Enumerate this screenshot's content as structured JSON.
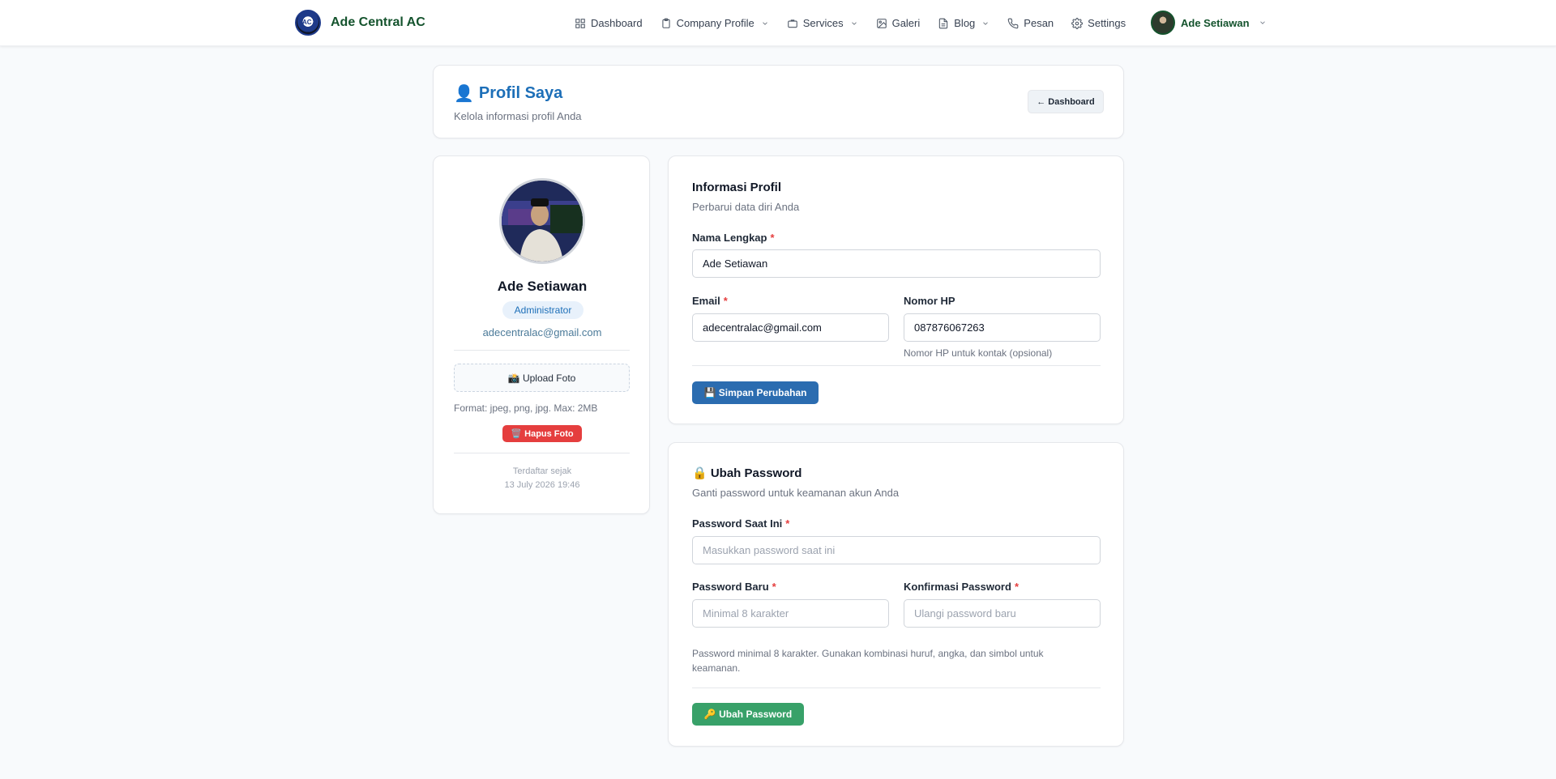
{
  "navbar": {
    "brand_name": "Ade Central AC",
    "items": [
      {
        "label": "Dashboard"
      },
      {
        "label": "Company Profile"
      },
      {
        "label": "Services"
      },
      {
        "label": "Galeri"
      },
      {
        "label": "Blog"
      },
      {
        "label": "Pesan"
      },
      {
        "label": "Settings"
      }
    ],
    "user_name": "Ade Setiawan"
  },
  "header": {
    "icon": "👤",
    "title": "Profil Saya",
    "subtitle": "Kelola informasi profil Anda",
    "back_label": "← Dashboard"
  },
  "profile": {
    "name": "Ade Setiawan",
    "role": "Administrator",
    "email": "adecentralac@gmail.com",
    "upload_label": "📸 Upload Foto",
    "format_text": "Format: jpeg, png, jpg. Max: 2MB",
    "delete_label": "🗑️ Hapus Foto",
    "registered_label": "Terdaftar sejak",
    "registered_date": "13 July 2026 19:46"
  },
  "info": {
    "title": "Informasi Profil",
    "subtitle": "Perbarui data diri Anda",
    "name_label": "Nama Lengkap",
    "name_value": "Ade Setiawan",
    "email_label": "Email",
    "email_value": "adecentralac@gmail.com",
    "phone_label": "Nomor HP",
    "phone_value": "087876067263",
    "phone_help": "Nomor HP untuk kontak (opsional)",
    "save_label": "💾 Simpan Perubahan"
  },
  "password": {
    "title": "🔒 Ubah Password",
    "subtitle": "Ganti password untuk keamanan akun Anda",
    "current_label": "Password Saat Ini",
    "current_placeholder": "Masukkan password saat ini",
    "new_label": "Password Baru",
    "new_placeholder": "Minimal 8 karakter",
    "confirm_label": "Konfirmasi Password",
    "confirm_placeholder": "Ulangi password baru",
    "help": "Password minimal 8 karakter. Gunakan kombinasi huruf, angka, dan simbol untuk keamanan.",
    "submit_label": "🔑 Ubah Password"
  },
  "required_mark": "*",
  "colors": {
    "brand_green": "#14532d",
    "accent_blue": "#1d6fb8",
    "primary_button": "#2b6cb0",
    "success_button": "#38a169",
    "danger_button": "#e53e3e"
  }
}
